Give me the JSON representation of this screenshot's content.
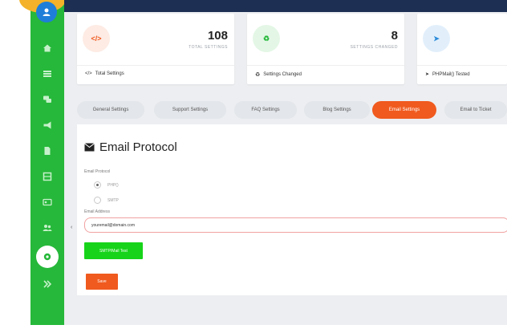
{
  "colors": {
    "sidebar": "#26b83a",
    "topbar": "#1d2f52",
    "accent": "#f05a1e",
    "test_button": "#17d41a",
    "avatar_ring": "#f3b229"
  },
  "sidebar": {
    "icons": [
      "user-avatar-icon",
      "home-icon",
      "list-icon",
      "chat-icon",
      "megaphone-icon",
      "document-icon",
      "table-icon",
      "id-card-icon",
      "users-icon",
      "settings-icon",
      "expand-icon"
    ],
    "active_item": "settings-icon"
  },
  "stats": [
    {
      "value": "108",
      "label": "TOTAL SETTINGS",
      "footer": "Total Settings",
      "icon": "code-icon",
      "color": "#f05a1e"
    },
    {
      "value": "8",
      "label": "SETTINGS CHANGED",
      "footer": "Settings Changed",
      "icon": "recycle-icon",
      "color": "#26b83a"
    },
    {
      "value": "",
      "label": "",
      "footer": "PHPMail() Tested",
      "icon": "send-icon",
      "color": "#2b8ad8"
    }
  ],
  "tabs": [
    {
      "label": "General Settings",
      "active": false
    },
    {
      "label": "Support Settings",
      "active": false
    },
    {
      "label": "FAQ Settings",
      "active": false
    },
    {
      "label": "Blog Settings",
      "active": false
    },
    {
      "label": "Email Settings",
      "active": true
    },
    {
      "label": "Email to Ticket",
      "active": false
    }
  ],
  "email_form": {
    "title": "Email Protocol",
    "protocol_label": "Email Protocol",
    "protocol_options": [
      {
        "label": "PHP()",
        "selected": true
      },
      {
        "label": "SMTP",
        "selected": false
      }
    ],
    "address_label": "Email Address",
    "address_value": "youremail@domain.com",
    "test_button": "SMTP/Mail Test",
    "save_button": "Save"
  }
}
